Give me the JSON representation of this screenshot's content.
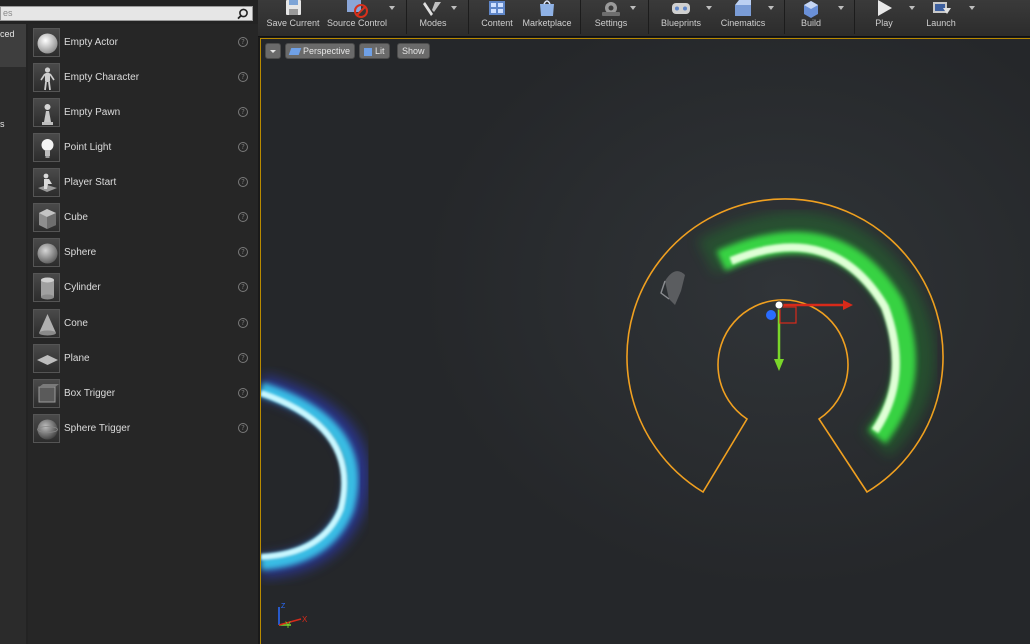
{
  "search": {
    "placeholder": "es"
  },
  "categories": [
    {
      "label": "ced",
      "active": true
    },
    {
      "label": "s",
      "active": false
    }
  ],
  "actors": [
    {
      "label": "Empty Actor",
      "icon": "sphere-white-icon"
    },
    {
      "label": "Empty Character",
      "icon": "mannequin-icon"
    },
    {
      "label": "Empty Pawn",
      "icon": "pawn-icon"
    },
    {
      "label": "Point Light",
      "icon": "lightbulb-icon"
    },
    {
      "label": "Player Start",
      "icon": "player-start-icon"
    },
    {
      "label": "Cube",
      "icon": "cube-icon"
    },
    {
      "label": "Sphere",
      "icon": "sphere-icon"
    },
    {
      "label": "Cylinder",
      "icon": "cylinder-icon"
    },
    {
      "label": "Cone",
      "icon": "cone-icon"
    },
    {
      "label": "Plane",
      "icon": "plane-icon"
    },
    {
      "label": "Box Trigger",
      "icon": "box-trigger-icon"
    },
    {
      "label": "Sphere Trigger",
      "icon": "sphere-trigger-icon"
    }
  ],
  "help_glyph": "?",
  "toolbar": {
    "save": "Save Current",
    "source_control": "Source Control",
    "modes": "Modes",
    "content": "Content",
    "marketplace": "Marketplace",
    "settings": "Settings",
    "blueprints": "Blueprints",
    "cinematics": "Cinematics",
    "build": "Build",
    "play": "Play",
    "launch": "Launch"
  },
  "viewport": {
    "perspective": "Perspective",
    "lit": "Lit",
    "show": "Show",
    "axis_y": "Y",
    "axis_x": "X",
    "axis_z": "Z"
  },
  "colors": {
    "selection": "#f0a020",
    "glow_green": "#3cff4a",
    "glow_blue": "#3ee0ff",
    "gizmo_x": "#d82a1a",
    "gizmo_y": "#7ad62a",
    "gizmo_z": "#2a6cff"
  }
}
